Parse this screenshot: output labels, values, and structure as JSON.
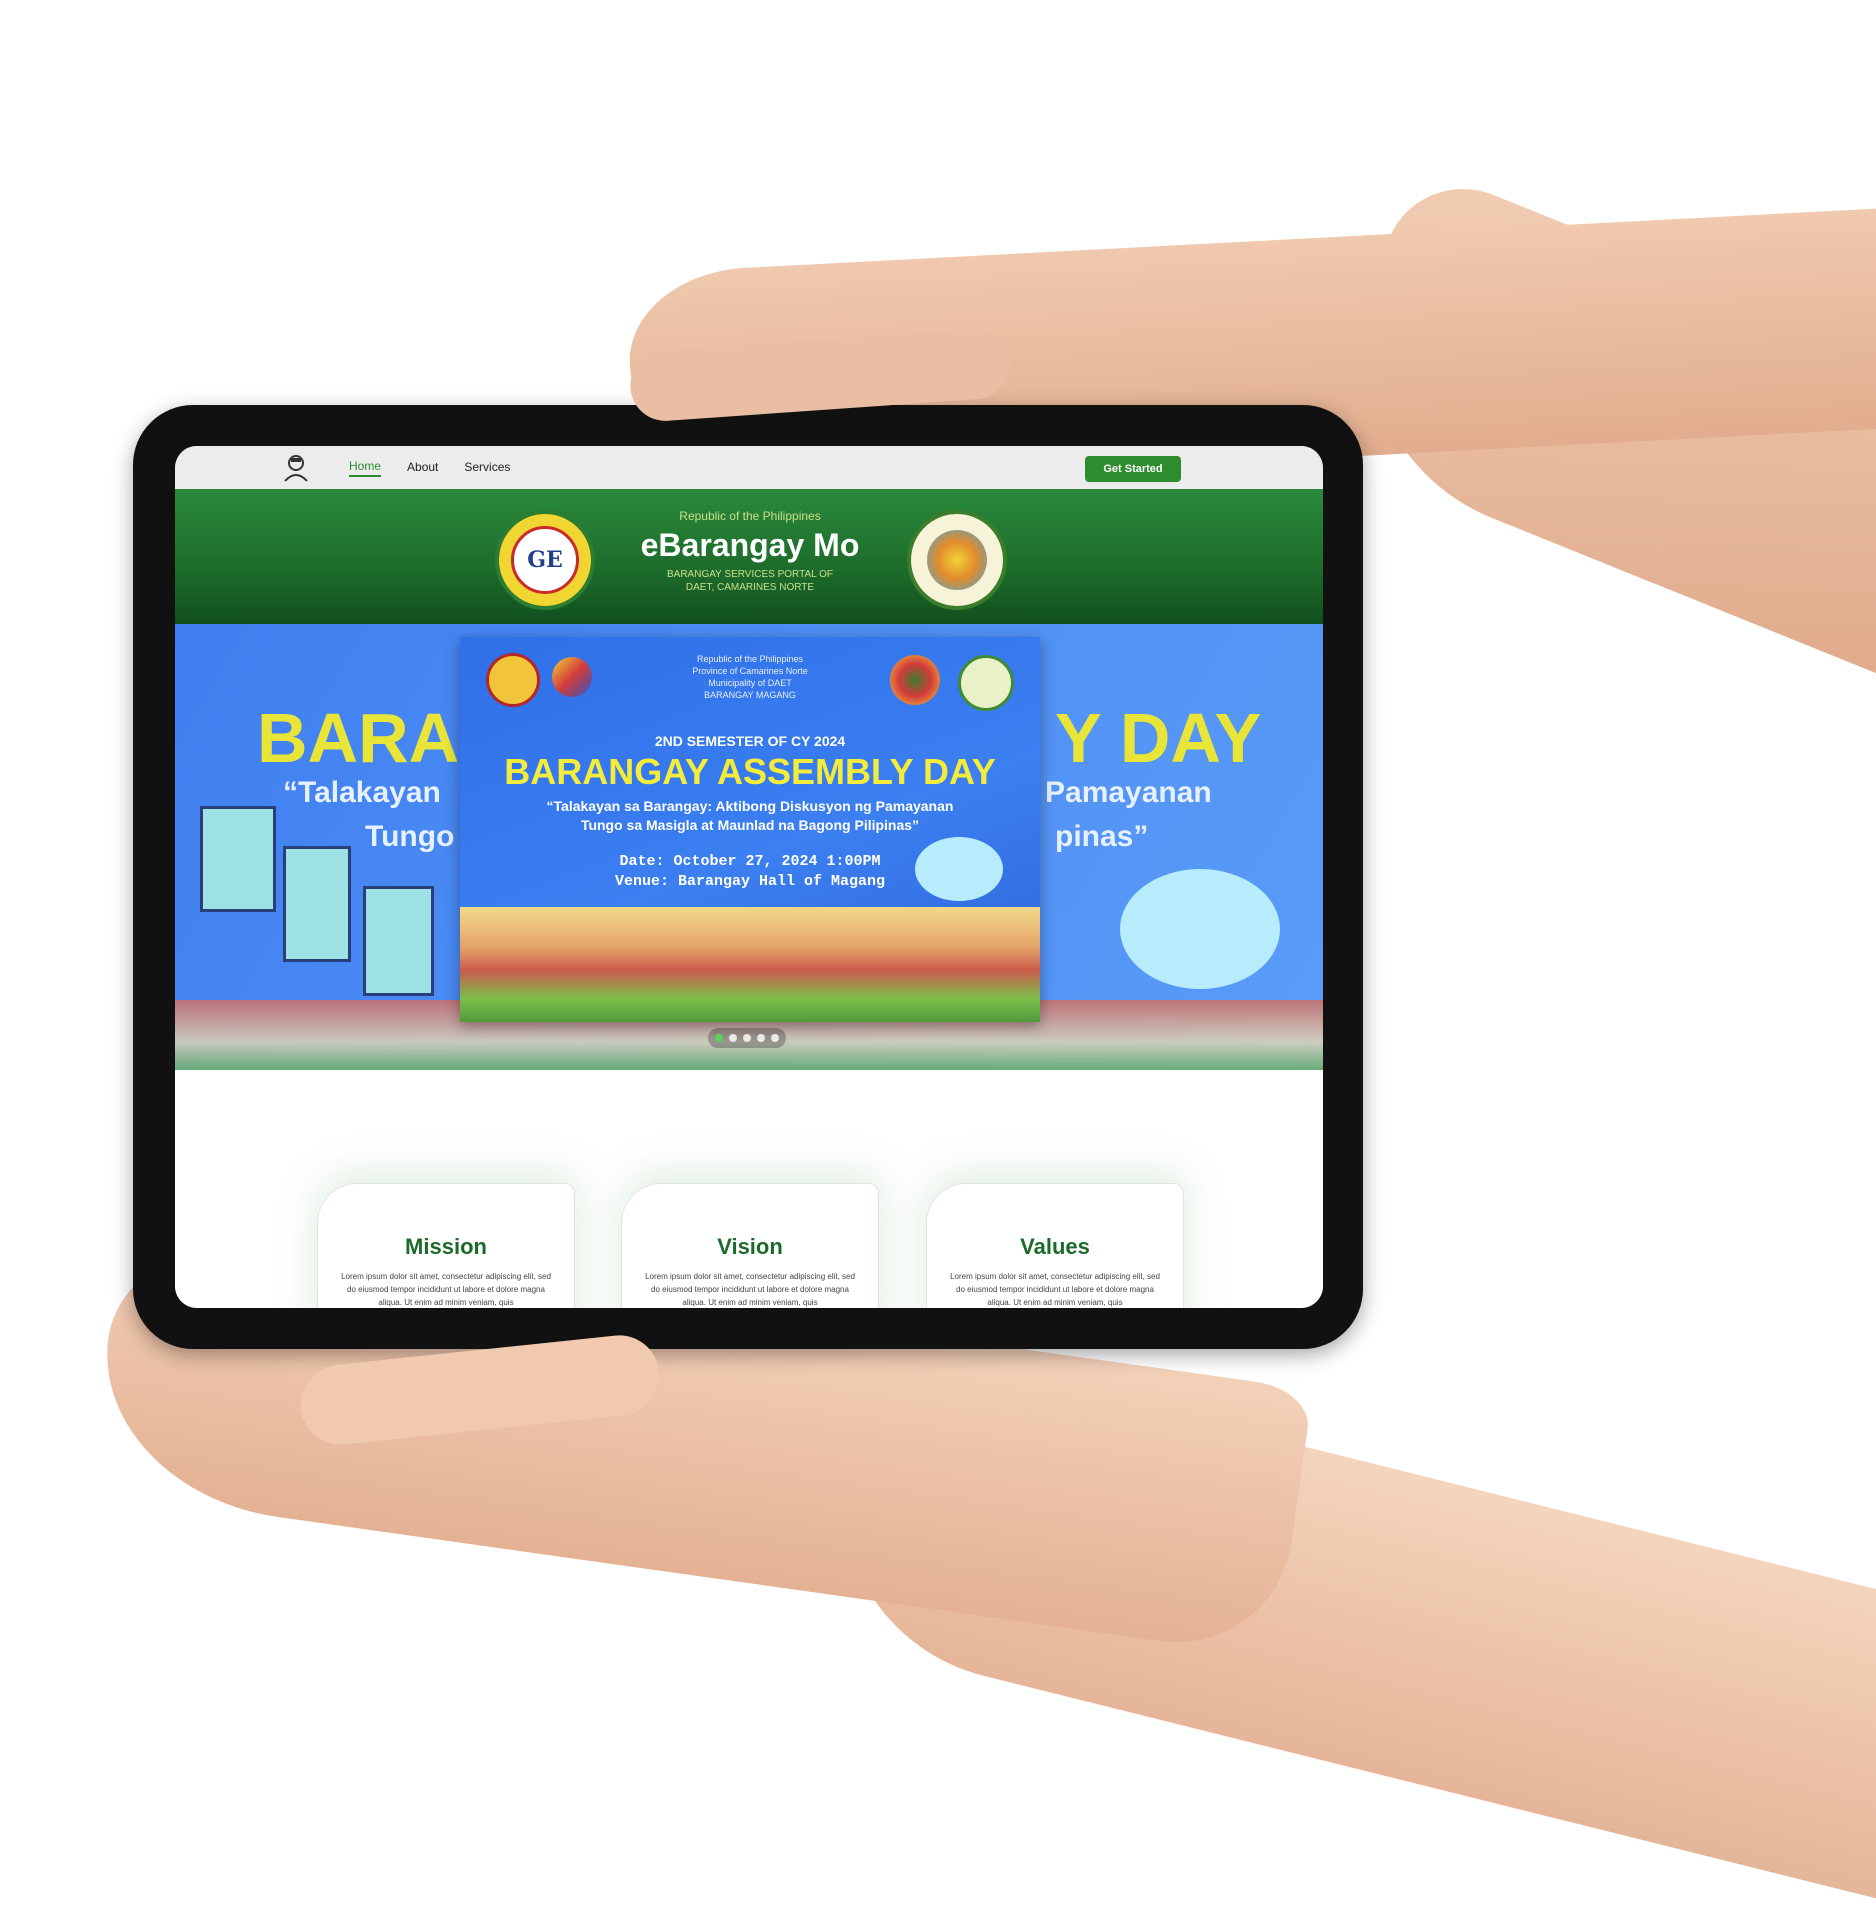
{
  "nav": {
    "links": [
      "Home",
      "About",
      "Services"
    ],
    "active": "Home",
    "cta_label": "Get Started"
  },
  "header": {
    "republic": "Republic of the Philippines",
    "title": "eBarangay Mo",
    "subtitle_line1": "BARANGAY SERVICES PORTAL OF",
    "subtitle_line2": "DAET, CAMARINES NORTE",
    "left_seal_text": "GE"
  },
  "hero": {
    "bg_title_left": "BARA",
    "bg_title_right": "Y DAY",
    "bg_sub_left_1": "“Talakayan",
    "bg_sub_left_2": "Tungo",
    "bg_sub_right_1": "Pamayanan",
    "bg_sub_right_2": "pinas”",
    "poster": {
      "header_lines": [
        "Republic of the Philippines",
        "Province of Camarines Norte",
        "Municipality of DAET",
        "BARANGAY MAGANG"
      ],
      "semester": "2ND SEMESTER OF CY 2024",
      "title": "BARANGAY ASSEMBLY DAY",
      "quote_line1": "“Talakayan sa Barangay: Aktibong Diskusyon ng Pamayanan",
      "quote_line2": "Tungo sa Masigla at Maunlad na Bagong Pilipinas”",
      "date": "Date: October 27, 2024 1:00PM",
      "venue": "Venue: Barangay Hall of Magang"
    },
    "slide_count": 5,
    "active_slide": 1
  },
  "cards": [
    {
      "title": "Mission",
      "body": "Lorem ipsum dolor sit amet, consectetur adipiscing elit, sed do eiusmod tempor incididunt ut labore et dolore magna aliqua. Ut enim ad minim veniam, quis"
    },
    {
      "title": "Vision",
      "body": "Lorem ipsum dolor sit amet, consectetur adipiscing elit, sed do eiusmod tempor incididunt ut labore et dolore magna aliqua. Ut enim ad minim veniam, quis"
    },
    {
      "title": "Values",
      "body": "Lorem ipsum dolor sit amet, consectetur adipiscing elit, sed do eiusmod tempor incididunt ut labore et dolore magna aliqua. Ut enim ad minim veniam, quis"
    }
  ],
  "colors": {
    "brand_green": "#2e8b2e",
    "header_green": "#1d6c2b",
    "hero_blue": "#3f7ff0",
    "poster_yellow": "#f3ec3a"
  }
}
